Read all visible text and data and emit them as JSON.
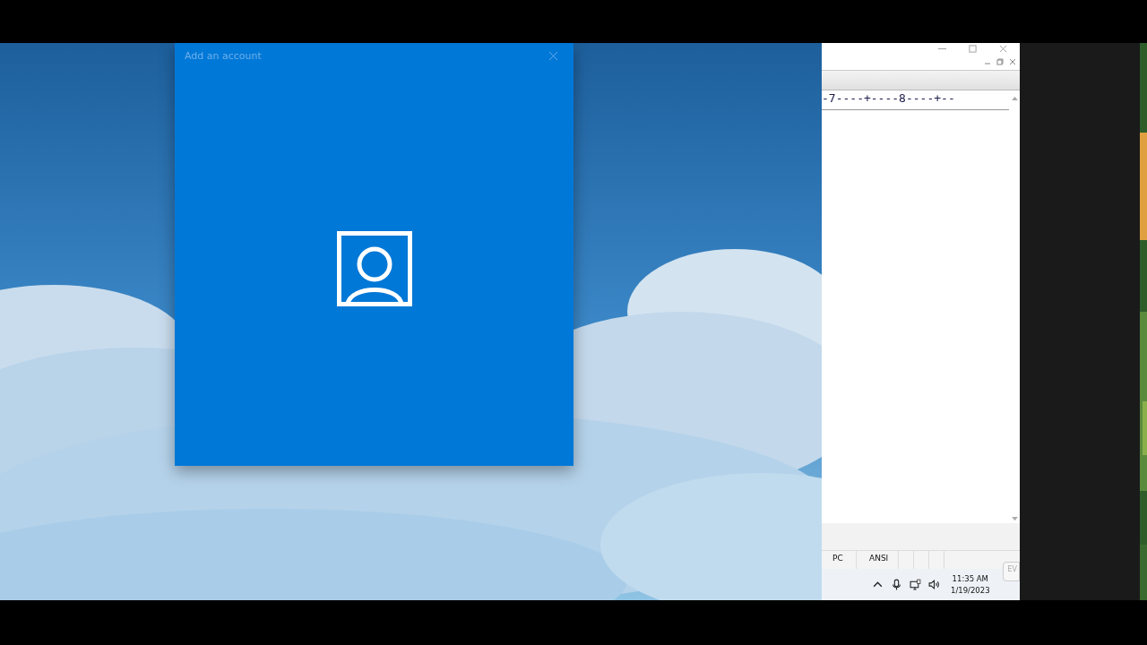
{
  "dialog": {
    "title": "Add an account"
  },
  "editor": {
    "ruler": "-7----+----8----+--",
    "status_cells": [
      "PC",
      "ANSI"
    ]
  },
  "taskbar": {
    "time": "11:35 AM",
    "date": "1/19/2023",
    "popup_text": "EV"
  }
}
